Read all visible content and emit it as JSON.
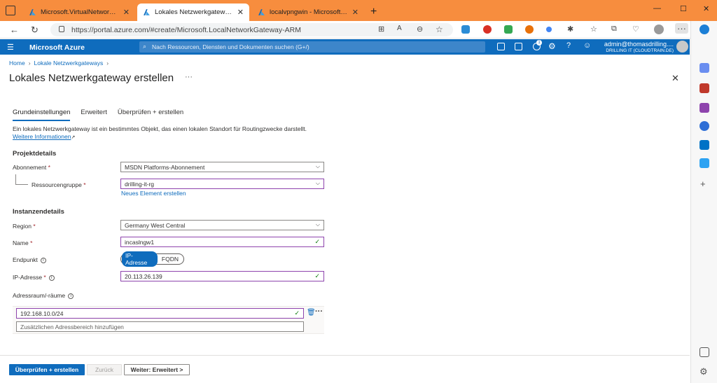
{
  "browser": {
    "tabs": [
      {
        "label": "Microsoft.VirtualNetworkGatewa",
        "close": "✕"
      },
      {
        "label": "Lokales Netzwerkgateway erstell",
        "close": "✕"
      },
      {
        "label": "localvpngwin - Microsoft Azure",
        "close": "✕"
      }
    ],
    "new_tab": "+",
    "url": "https://portal.azure.com/#create/Microsoft.LocalNetworkGateway-ARM",
    "window_controls": {
      "minimize": "—",
      "maximize": "☐",
      "close": "✕"
    }
  },
  "azure_header": {
    "brand": "Microsoft Azure",
    "search_placeholder": "Nach Ressourcen, Diensten und Dokumenten suchen (G+/)",
    "user_name": "admin@thomasdrilling....",
    "user_tenant": "DRILLING IT (CLOUDTRAIN.DE)",
    "notification_count": "1"
  },
  "breadcrumb": [
    "Home",
    "Lokale Netzwerkgateways"
  ],
  "page_title": "Lokales Netzwerkgateway erstellen",
  "ellipsis": "···",
  "tabs": [
    "Grundeinstellungen",
    "Erweitert",
    "Überprüfen + erstellen"
  ],
  "intro": {
    "text": "Ein lokales Netzwerkgateway ist ein bestimmtes Objekt, das einen lokalen Standort für Routingzwecke darstellt.",
    "link": "Weitere Informationen"
  },
  "project": {
    "heading": "Projektdetails",
    "subscription_label": "Abonnement",
    "subscription_value": "MSDN Platforms-Abonnement",
    "rg_label": "Ressourcengruppe",
    "rg_value": "drilling-it-rg",
    "new_link": "Neues Element erstellen"
  },
  "instance": {
    "heading": "Instanzendetails",
    "region_label": "Region",
    "region_value": "Germany West Central",
    "name_label": "Name",
    "name_value": "incaslngw1",
    "endpoint_label": "Endpunkt",
    "endpoint_options": [
      "IP-Adresse",
      "FQDN"
    ],
    "ip_label": "IP-Adresse",
    "ip_value": "20.113.26.139",
    "addrspace_label": "Adressraum/-räume",
    "addrspace_value": "192.168.10.0/24",
    "addrspace_placeholder": "Zusätzlichen Adressbereich hinzufügen"
  },
  "footer": {
    "review_create": "Überprüfen + erstellen",
    "back": "Zurück",
    "next": "Weiter: Erweitert >"
  }
}
